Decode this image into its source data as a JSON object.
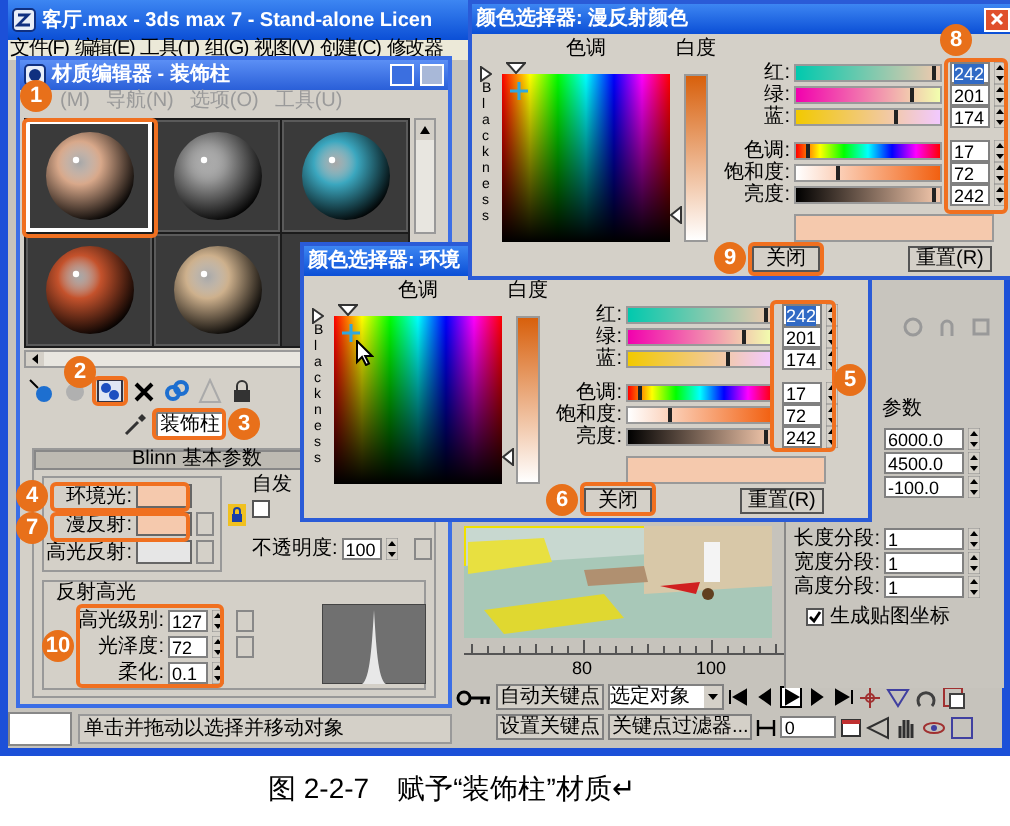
{
  "main_window": {
    "title": "客厅.max - 3ds max 7 - Stand-alone Licen",
    "menu": [
      "文件(F)",
      "编辑(E)",
      "工具(T)",
      "组(G)",
      "视图(V)",
      "创建(C)",
      "修改器"
    ]
  },
  "material_editor": {
    "title": "材质编辑器 - 装饰柱",
    "menu": [
      "(M)",
      "导航(N)",
      "选项(O)",
      "工具(U)"
    ],
    "slots": [
      {
        "color": "#d8a88a",
        "selected": true
      },
      {
        "color": "#8c8c8c",
        "selected": false
      },
      {
        "color": "#3ba7bf",
        "selected": false
      },
      {
        "color": "#c4522c",
        "selected": false
      },
      {
        "color": "#cdb08c",
        "selected": false
      }
    ],
    "material_name": "装饰柱",
    "rollout_title": "Blinn 基本参数",
    "color_swatches": [
      {
        "label": "环境光:",
        "color": "#f5c9ad"
      },
      {
        "label": "漫反射:",
        "color": "#f5c9ad"
      },
      {
        "label": "高光反射:",
        "color": "#e6e6e6"
      }
    ],
    "self_illumination": {
      "label": "自发",
      "checked": false
    },
    "opacity": {
      "label": "不透明度:",
      "value": "100"
    },
    "specular_highlights": {
      "title": "反射高光",
      "fields": [
        {
          "label": "高光级别:",
          "value": "127"
        },
        {
          "label": "光泽度:",
          "value": "72"
        },
        {
          "label": "柔化:",
          "value": "0.1"
        }
      ]
    }
  },
  "command_panel": {
    "heading": "参数",
    "fields": [
      {
        "value": "6000.0"
      },
      {
        "value": "4500.0"
      },
      {
        "value": "-100.0"
      },
      {
        "label": "长度分段:",
        "value": "1"
      },
      {
        "label": "宽度分段:",
        "value": "1"
      },
      {
        "label": "高度分段:",
        "value": "1"
      }
    ],
    "checkbox": {
      "label": "生成贴图坐标",
      "checked": true
    }
  },
  "timeline": {
    "ticks": [
      "80",
      "100"
    ]
  },
  "animation_controls": {
    "auto_key": "自动关键点",
    "key_target": "选定对象",
    "set_key": "设置关键点",
    "key_filters": "关键点过滤器...",
    "frame": "0"
  },
  "status_bar": "单击并拖动以选择并移动对象",
  "color_pickers": [
    {
      "title": "颜色选择器: 漫反射颜色",
      "hue_label": "色调",
      "whiteness_label": "白度",
      "blackness_label": "Blackness",
      "channels": [
        {
          "label": "红:",
          "value": "242",
          "level": 0.95,
          "selected": true
        },
        {
          "label": "绿:",
          "value": "201",
          "level": 0.79,
          "selected": false
        },
        {
          "label": "蓝:",
          "value": "174",
          "level": 0.68,
          "selected": false
        },
        {
          "label": "色调:",
          "value": "17",
          "level": 0.07,
          "selected": false
        },
        {
          "label": "饱和度:",
          "value": "72",
          "level": 0.28,
          "selected": false
        },
        {
          "label": "亮度:",
          "value": "242",
          "level": 0.95,
          "selected": false
        }
      ],
      "swatch": {
        "color": "#f5c9ad"
      },
      "close": "关闭",
      "reset": "重置(R)"
    },
    {
      "title": "颜色选择器: 环境",
      "hue_label": "色调",
      "whiteness_label": "白度",
      "blackness_label": "Blackness",
      "channels": [
        {
          "label": "红:",
          "value": "242",
          "level": 0.95,
          "selected": true
        },
        {
          "label": "绿:",
          "value": "201",
          "level": 0.79,
          "selected": false
        },
        {
          "label": "蓝:",
          "value": "174",
          "level": 0.68,
          "selected": false
        },
        {
          "label": "色调:",
          "value": "17",
          "level": 0.07,
          "selected": false
        },
        {
          "label": "饱和度:",
          "value": "72",
          "level": 0.28,
          "selected": false
        },
        {
          "label": "亮度:",
          "value": "242",
          "level": 0.95,
          "selected": false
        }
      ],
      "swatch": {
        "color": "#f5c9ad"
      },
      "close": "关闭",
      "reset": "重置(R)"
    }
  ],
  "annotations": [
    {
      "label": "1"
    },
    {
      "label": "2"
    },
    {
      "label": "3"
    },
    {
      "label": "4"
    },
    {
      "label": "5"
    },
    {
      "label": "6"
    },
    {
      "label": "7"
    },
    {
      "label": "8"
    },
    {
      "label": "9"
    },
    {
      "label": "10"
    }
  ],
  "caption": "图 2-2-7　赋予“装饰柱”材质↵"
}
